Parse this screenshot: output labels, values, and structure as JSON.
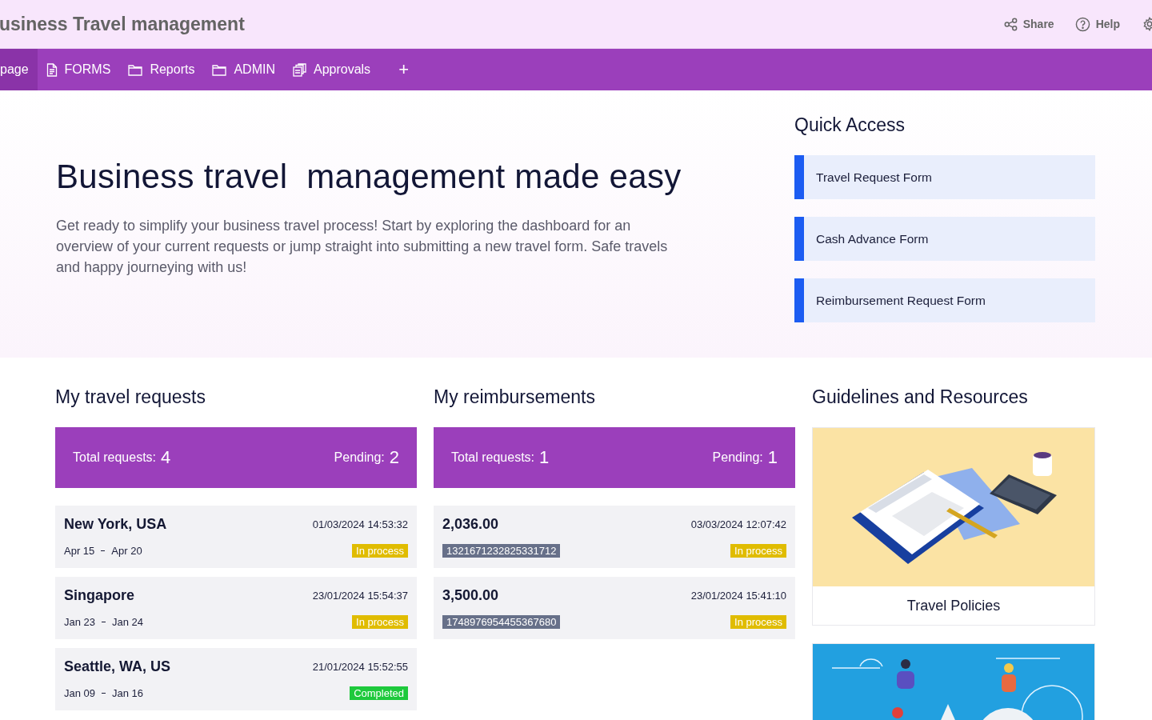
{
  "header": {
    "title": "usiness Travel management",
    "actions": [
      "Share",
      "Help"
    ]
  },
  "tabs": [
    {
      "label": "page",
      "selected": true
    },
    {
      "label": "FORMS",
      "selected": false
    },
    {
      "label": "Reports",
      "selected": false
    },
    {
      "label": "ADMIN",
      "selected": false
    },
    {
      "label": "Approvals",
      "selected": false
    }
  ],
  "add_tab": "+",
  "hero": {
    "heading": "Business travel  management made easy",
    "text": "Get ready to simplify your business travel process! Start by exploring the dashboard for an overview of your current requests or jump straight into submitting a new travel form. Safe travels and happy journeying with us!"
  },
  "quick_access": {
    "title": "Quick Access",
    "items": [
      "Travel Request Form",
      "Cash Advance Form",
      "Reimbursement Request Form"
    ]
  },
  "travel_requests": {
    "title": "My travel requests",
    "total_label": "Total requests:",
    "total": "4",
    "pending_label": "Pending:",
    "pending": "2",
    "items": [
      {
        "title": "New York, USA",
        "timestamp": "01/03/2024 14:53:32",
        "from": "Apr 15",
        "to": "Apr 20",
        "status": "In process",
        "color": "#e0bc00"
      },
      {
        "title": "Singapore",
        "timestamp": "23/01/2024 15:54:37",
        "from": "Jan 23",
        "to": "Jan 24",
        "status": "In process",
        "color": "#e0bc00"
      },
      {
        "title": "Seattle, WA, US",
        "timestamp": "21/01/2024 15:52:55",
        "from": "Jan 09",
        "to": "Jan 16",
        "status": "Completed",
        "color": "#1ec93c"
      }
    ]
  },
  "reimbursements": {
    "title": "My reimbursements",
    "total_label": "Total requests:",
    "total": "1",
    "pending_label": "Pending:",
    "pending": "1",
    "items": [
      {
        "amount": "2,036.00",
        "timestamp": "03/03/2024 12:07:42",
        "reference": "1321671232825331712",
        "status": "In process",
        "color": "#e0bc00"
      },
      {
        "amount": "3,500.00",
        "timestamp": "23/01/2024 15:41:10",
        "reference": "1748976954455367680",
        "status": "In process",
        "color": "#e0bc00"
      }
    ]
  },
  "guidelines": {
    "title": "Guidelines and Resources",
    "cards": [
      {
        "kind": "picture",
        "label": "Travel Policies"
      },
      {
        "kind": "picture"
      }
    ]
  }
}
